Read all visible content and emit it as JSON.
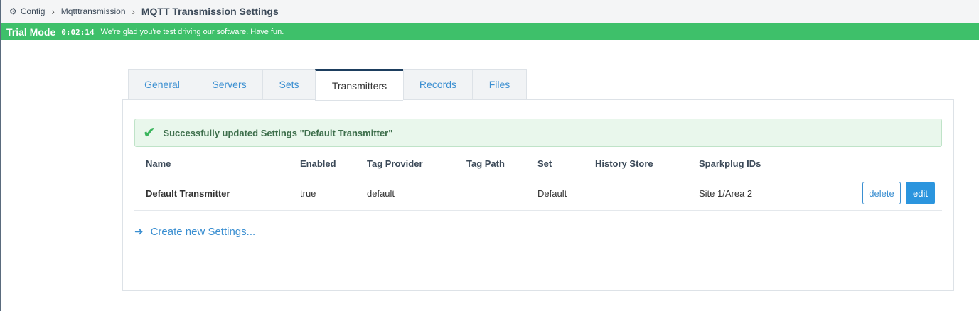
{
  "breadcrumb": {
    "icon": "gear-icon",
    "items": [
      "Config",
      "Mqtttransmission"
    ],
    "current": "MQTT Transmission Settings"
  },
  "trial": {
    "mode": "Trial Mode",
    "timer": "0:02:14",
    "message": "We're glad you're test driving our software. Have fun.",
    "color": "#3ec06a"
  },
  "tabs": [
    {
      "label": "General"
    },
    {
      "label": "Servers"
    },
    {
      "label": "Sets"
    },
    {
      "label": "Transmitters",
      "active": true
    },
    {
      "label": "Records"
    },
    {
      "label": "Files"
    }
  ],
  "alert": {
    "icon": "check-icon",
    "text": "Successfully updated Settings \"Default Transmitter\""
  },
  "table": {
    "headers": [
      "Name",
      "Enabled",
      "Tag Provider",
      "Tag Path",
      "Set",
      "History Store",
      "Sparkplug IDs"
    ],
    "rows": [
      {
        "name": "Default Transmitter",
        "enabled": "true",
        "tag_provider": "default",
        "tag_path": "",
        "set": "Default",
        "history_store": "",
        "sparkplug_ids": "Site 1/Area 2",
        "delete_label": "delete",
        "edit_label": "edit"
      }
    ]
  },
  "create": {
    "icon": "arrow-right-icon",
    "label": "Create new Settings..."
  },
  "colors": {
    "accent": "#3b8fd1",
    "success_bg": "#e9f7ec",
    "primary_button": "#2b95de",
    "active_tab_border": "#1d3e5e"
  }
}
